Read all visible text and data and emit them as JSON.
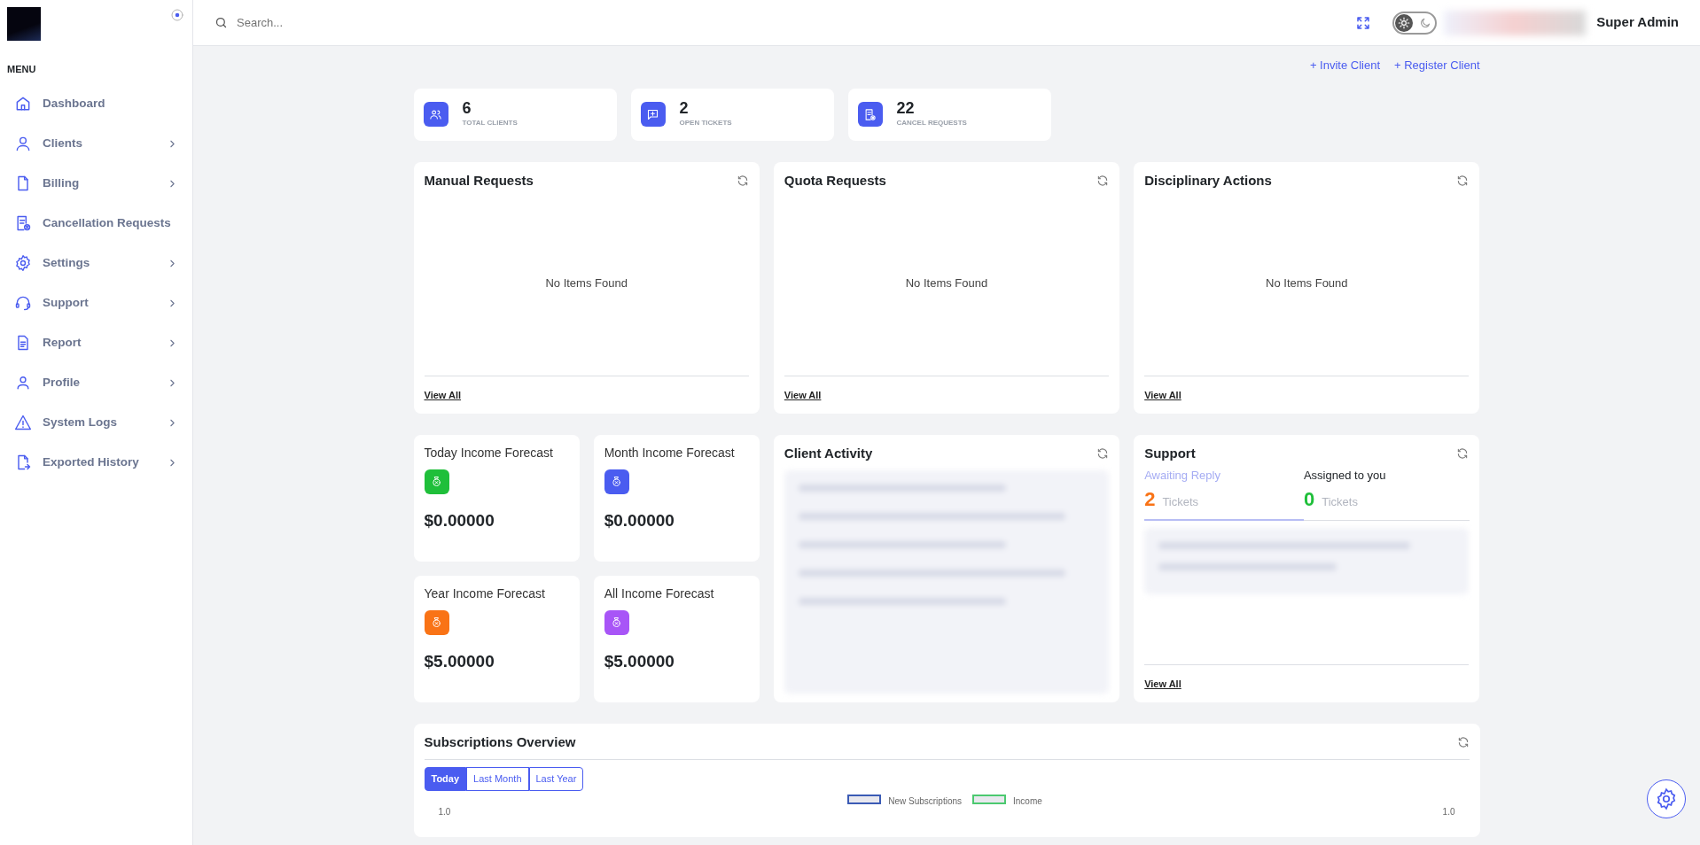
{
  "sidebar": {
    "menu_label": "MENU",
    "items": [
      {
        "label": "Dashboard",
        "expandable": false
      },
      {
        "label": "Clients",
        "expandable": true
      },
      {
        "label": "Billing",
        "expandable": true
      },
      {
        "label": "Cancellation Requests",
        "expandable": false
      },
      {
        "label": "Settings",
        "expandable": true
      },
      {
        "label": "Support",
        "expandable": true
      },
      {
        "label": "Report",
        "expandable": true
      },
      {
        "label": "Profile",
        "expandable": true
      },
      {
        "label": "System Logs",
        "expandable": true
      },
      {
        "label": "Exported History",
        "expandable": true
      }
    ]
  },
  "topbar": {
    "search": {
      "placeholder": "Search..."
    },
    "theme_dark": false,
    "user_name": "Super Admin"
  },
  "actions": [
    "+ Invite Client",
    "+ Register Client"
  ],
  "stats": [
    {
      "value": "6",
      "label": "TOTAL CLIENTS"
    },
    {
      "value": "2",
      "label": "OPEN TICKETS"
    },
    {
      "value": "22",
      "label": "CANCEL REQUESTS"
    }
  ],
  "panels": [
    {
      "title": "Manual Requests",
      "empty_text": "No Items Found",
      "link": "View All"
    },
    {
      "title": "Quota Requests",
      "empty_text": "No Items Found",
      "link": "View All"
    },
    {
      "title": "Disciplinary Actions",
      "empty_text": "No Items Found",
      "link": "View All"
    }
  ],
  "forecasts": [
    {
      "title": "Today Income Forecast",
      "amount": "$0.00000",
      "color": "#1fbf3a"
    },
    {
      "title": "Month Income Forecast",
      "amount": "$0.00000",
      "color": "#4a5cf0"
    },
    {
      "title": "Year Income Forecast",
      "amount": "$5.00000",
      "color": "#f97316"
    },
    {
      "title": "All Income Forecast",
      "amount": "$5.00000",
      "color": "#a855f7"
    }
  ],
  "client_activity": {
    "title": "Client Activity"
  },
  "support": {
    "title": "Support",
    "tabs": [
      {
        "label": "Awaiting Reply",
        "count": "2",
        "unit": "Tickets",
        "color": "#f97316",
        "selected": true
      },
      {
        "label": "Assigned to you",
        "count": "0",
        "unit": "Tickets",
        "color": "#1fbf3a",
        "selected": false
      }
    ],
    "link": "View All"
  },
  "subscriptions": {
    "title": "Subscriptions Overview",
    "ranges": [
      {
        "label": "Today",
        "selected": true
      },
      {
        "label": "Last Month",
        "selected": false
      },
      {
        "label": "Last Year",
        "selected": false
      }
    ],
    "legend": [
      {
        "label": "New Subscriptions",
        "color": "#3b5bb5"
      },
      {
        "label": "Income",
        "color": "#4cc970"
      }
    ],
    "left_tick": "1.0",
    "right_tick": "1.0"
  }
}
